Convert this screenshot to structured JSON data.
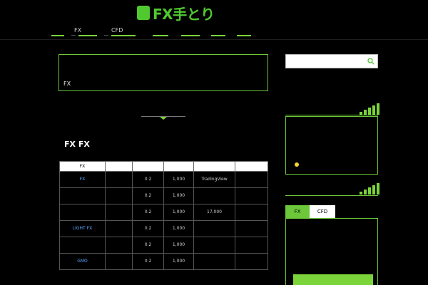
{
  "header": {
    "logo_text": "FX手とり",
    "tagline": ""
  },
  "nav": {
    "items": [
      {
        "label": ""
      },
      {
        "label": "FX"
      },
      {
        "label": "CFD"
      },
      {
        "label": ""
      },
      {
        "label": ""
      },
      {
        "label": ""
      },
      {
        "label": ""
      }
    ]
  },
  "intro": {
    "lines": [
      "",
      "",
      "FX"
    ]
  },
  "section": {
    "heading": "FX FX"
  },
  "table": {
    "headers": [
      "FX",
      "",
      "",
      "",
      "",
      ""
    ],
    "rows": [
      {
        "broker": "FX",
        "c2": "",
        "c3": "0.2",
        "c4": "1,000",
        "c5": "TradingView",
        "c6": ""
      },
      {
        "broker": "",
        "c2": "",
        "c3": "0.2",
        "c4": "1,000",
        "c5": "",
        "c6": ""
      },
      {
        "broker": "",
        "c2": "",
        "c3": "0.2",
        "c4": "1,000",
        "c5": "17,000",
        "c6": ""
      },
      {
        "broker": "LIGHT FX",
        "c2": "",
        "c3": "0.2",
        "c4": "1,000",
        "c5": "",
        "c6": ""
      },
      {
        "broker": "",
        "c2": "",
        "c3": "0.2",
        "c4": "1,000",
        "c5": "",
        "c6": ""
      },
      {
        "broker": "GMO",
        "c2": "",
        "c3": "0.2",
        "c4": "1,000",
        "c5": "",
        "c6": ""
      }
    ]
  },
  "below_text": [
    "",
    ""
  ],
  "sidebar": {
    "search_placeholder": "",
    "widget1_title": "",
    "widget1_link": "",
    "widget2_title": "",
    "tabs": [
      {
        "label": "FX"
      },
      {
        "label": "CFD"
      }
    ],
    "panel_items": [
      "",
      "",
      ""
    ]
  },
  "colors": {
    "accent": "#7bd53a",
    "border": "#6cc83a",
    "link": "#5aa9ff",
    "background": "#000000"
  }
}
